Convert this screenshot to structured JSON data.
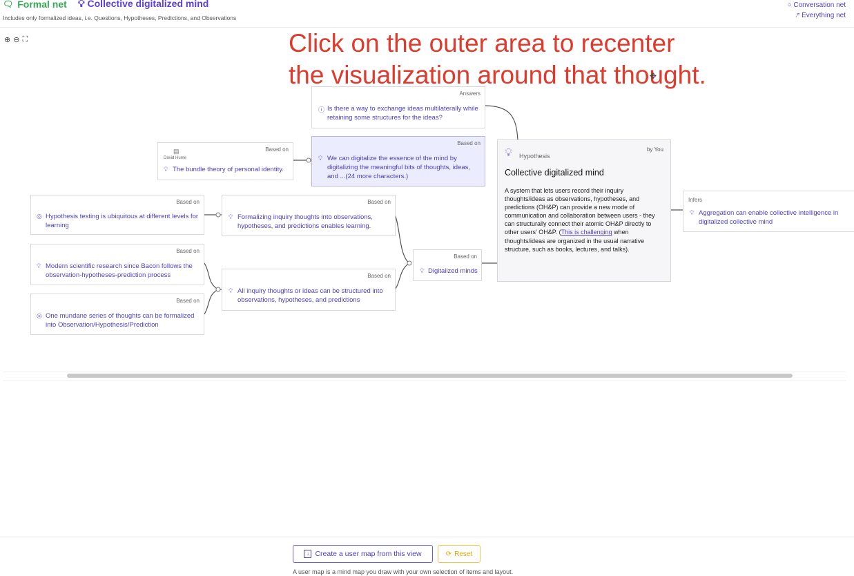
{
  "header": {
    "net_label": "Formal net",
    "title": "Collective digitalized mind",
    "subtitle": "Includes only formalized ideas, i.e. Questions, Hypotheses, Predictions, and Observations",
    "links": [
      "Conversation net",
      "Everything net"
    ]
  },
  "overlay_text": [
    "Click on the outer area to recenter",
    "the visualization around that thought."
  ],
  "nodes": {
    "answers": {
      "relation": "Answers",
      "text": "Is there a way to exchange ideas multilaterally while retaining some structures for the ideas?"
    },
    "hume": {
      "relation": "Based on",
      "author": "David Hume",
      "text": "The bundle theory of personal identity."
    },
    "digitalize": {
      "relation": "Based on",
      "text": "We can digitalize the essence of the mind by digitalizing the meaningful bits of thoughts, ideas, and ...(24 more characters.)"
    },
    "hyp_testing": {
      "relation": "Based on",
      "text": "Hypothesis testing is ubiquitous at different levels for learning"
    },
    "formalizing": {
      "relation": "Based on",
      "text": "Formalizing inquiry thoughts into observations, hypotheses, and predictions enables learning."
    },
    "modern": {
      "relation": "Based on",
      "text": "Modern scientific research since Bacon follows the observation-hypotheses-prediction process"
    },
    "all_inquiry": {
      "relation": "Based on",
      "text": "All inquiry thoughts or ideas can be structured into observations, hypotheses, and predictions"
    },
    "mundane": {
      "relation": "Based on",
      "text": "One mundane series of thoughts can be formalized into Observation/Hypothesis/Prediction"
    },
    "digital_minds": {
      "relation": "Based on",
      "text": "Digitalized minds"
    },
    "aggregation": {
      "relation": "Infers",
      "text": "Aggregation can enable collective intelligence in digitalized collective mind"
    }
  },
  "main": {
    "kind": "Hypothesis",
    "by": "by You",
    "title": "Collective digitalized mind",
    "body_before": "A system that lets users record their inquiry thoughts/ideas as observations, hypotheses, and predictions (OH&P) can provide a new mode of communication and collaboration between users - they can structurally connect their atomic OH&P directly to other users' OH&P. (",
    "body_link": "This is challenging",
    "body_after": " when thoughts/ideas are organized in the usual narrative structure, such as books, lectures, and talks)."
  },
  "footer": {
    "create_label": "Create a user map from this view",
    "reset_label": "Reset",
    "note": "A user map is a mind map you draw with your own selection of items and layout."
  },
  "colors": {
    "accent": "#4b3fc8",
    "net_green": "#34a853",
    "overlay_red": "#dd3b2d",
    "reset_yellow": "#e0a800"
  }
}
